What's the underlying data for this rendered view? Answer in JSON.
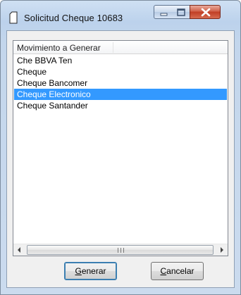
{
  "window": {
    "title": "Solicitud Cheque 10683",
    "icon": "document-icon"
  },
  "caption_buttons": {
    "minimize": "minimize-icon",
    "maximize": "maximize-icon",
    "close": "close-icon"
  },
  "listview": {
    "column_header": "Movimiento a Generar",
    "items": [
      {
        "label": "Che BBVA Ten",
        "selected": false
      },
      {
        "label": "Cheque",
        "selected": false
      },
      {
        "label": "Cheque Bancomer",
        "selected": false
      },
      {
        "label": "Cheque Electronico",
        "selected": true
      },
      {
        "label": "Cheque Santander",
        "selected": false
      }
    ],
    "selected_color": "#3399ff"
  },
  "buttons": {
    "generar": {
      "mnemonic": "G",
      "rest": "enerar"
    },
    "cancelar": {
      "mnemonic": "C",
      "rest": "ancelar"
    }
  }
}
